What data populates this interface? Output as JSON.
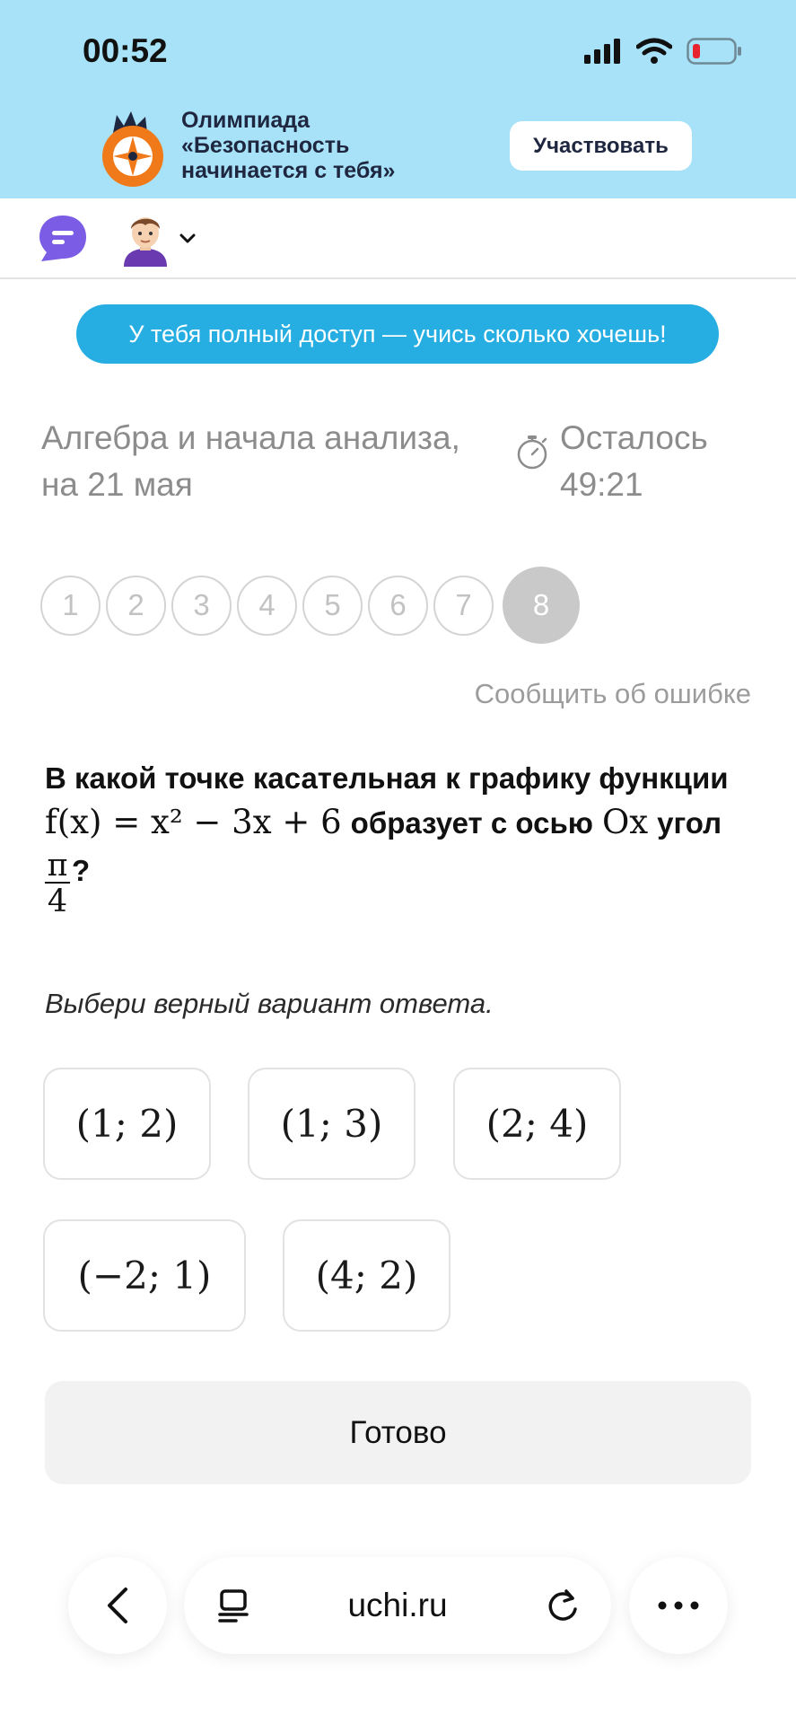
{
  "status": {
    "time": "00:52"
  },
  "promo": {
    "title_line1": "Олимпиада",
    "title_line2": "«Безопасность",
    "title_line3": "начинается с тебя»",
    "button": "Участвовать",
    "brand_color": "#a7e2f8"
  },
  "nav": {
    "chat_icon": "chat-bubble-icon",
    "avatar_icon": "user-avatar"
  },
  "access": {
    "text": "У тебя полный доступ — учись сколько хочешь!",
    "color": "#26aee3"
  },
  "lesson": {
    "subject_line1": "Алгебра и начала анализа,",
    "subject_line2": "на 21 мая",
    "timer_label": "Осталось",
    "timer_value": "49:21"
  },
  "steps": [
    "1",
    "2",
    "3",
    "4",
    "5",
    "6",
    "7",
    "8"
  ],
  "report_error": "Сообщить об ошибке",
  "question": {
    "part1": "В какой точке касательная к графику функции",
    "formula": "f(x) = x² − 3x + 6",
    "part2": "образует с осью",
    "axis": "Ox",
    "part3": "угол",
    "angle_num": "π",
    "angle_den": "4",
    "qmark": "?"
  },
  "hint": "Выбери верный вариант ответа.",
  "options": [
    "(1; 2)",
    "(1; 3)",
    "(2; 4)",
    "(−2; 1)",
    "(4; 2)"
  ],
  "done_button": "Готово",
  "browser": {
    "url": "uchi.ru"
  }
}
